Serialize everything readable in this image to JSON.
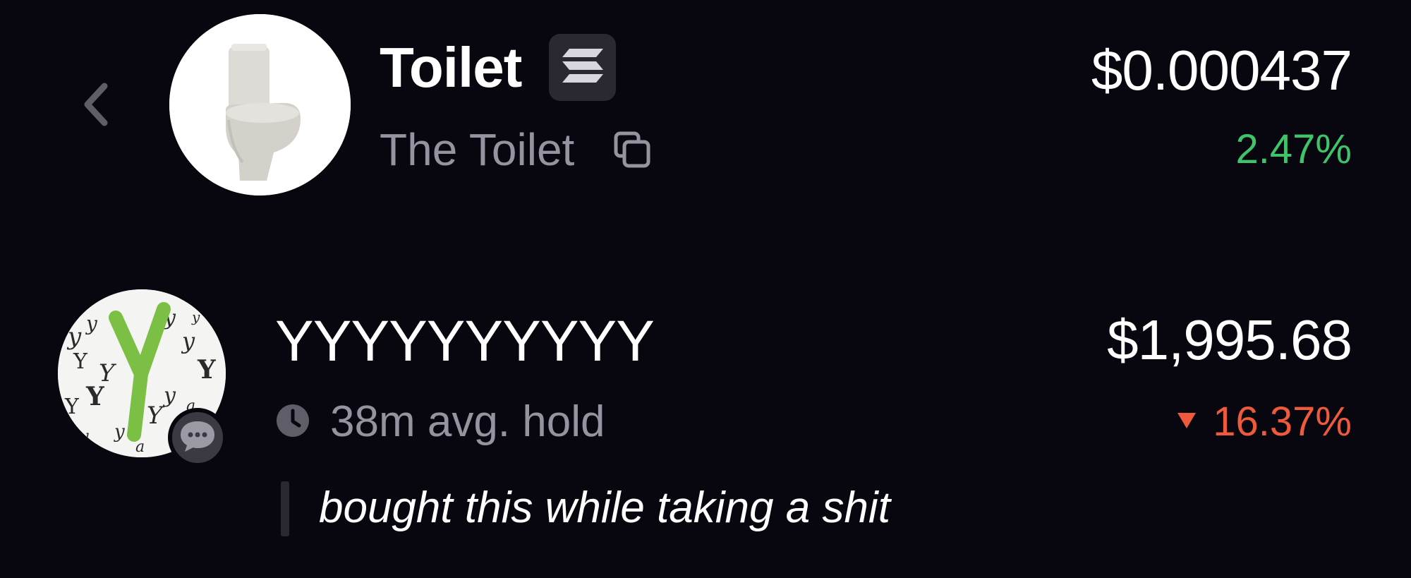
{
  "token": {
    "symbol": "Toilet",
    "name": "The Toilet",
    "price": "$0.000437",
    "change": "2.47%",
    "change_color": "#3fc36b",
    "chain_icon": "solana-icon"
  },
  "trader": {
    "username": "YYYYYYYYYY",
    "avg_hold": "38m avg. hold",
    "position_value": "$1,995.68",
    "change": "16.37%",
    "change_direction": "down",
    "change_color": "#ef5a3c",
    "comment": "bought this while taking a shit"
  },
  "icons": {
    "back": "chevron-left-icon",
    "copy": "copy-icon",
    "clock": "clock-icon",
    "chat": "chat-bubble-icon",
    "down": "triangle-down-icon"
  }
}
